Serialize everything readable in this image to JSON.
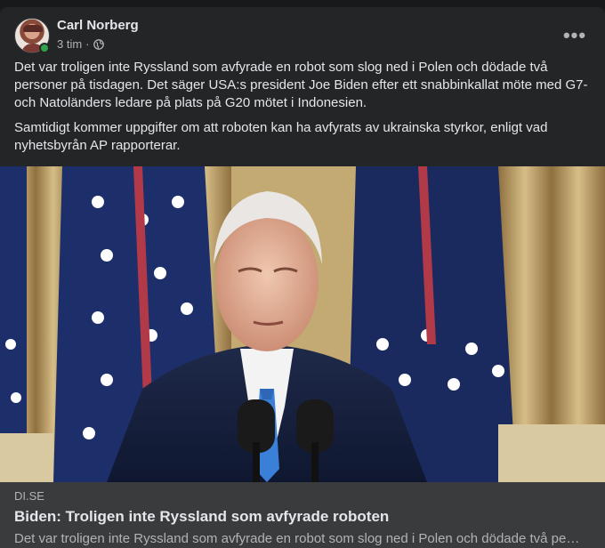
{
  "post": {
    "author": "Carl Norberg",
    "time": "3 tim",
    "separator": "·",
    "audience_icon": "globe-icon",
    "more_icon": "more-options-icon",
    "paragraphs": [
      "Det var troligen inte Ryssland som avfyrade en robot som slog ned i Polen och dödade två personer på tisdagen. Det säger USA:s president Joe Biden efter ett snabbinkallat möte med G7- och Natoländers ledare på plats på G20 mötet i Indonesien.",
      "Samtidigt kommer uppgifter om att roboten kan ha avfyrats av ukrainska styrkor, enligt vad nyhetsbyrån AP rapporterar."
    ]
  },
  "link": {
    "domain": "DI.SE",
    "title": "Biden: Troligen inte Ryssland som avfyrade roboten",
    "description": "Det var troligen inte Ryssland som avfyrade en robot som slog ned i Polen och dödade två pe…"
  },
  "colors": {
    "background": "#18191a",
    "card": "#242526",
    "preview": "#3a3b3c",
    "online": "#31a24c"
  }
}
